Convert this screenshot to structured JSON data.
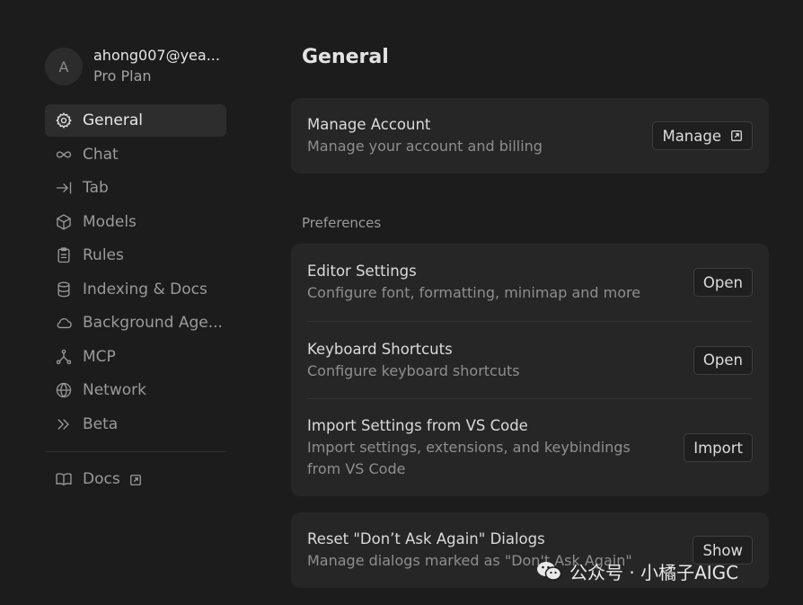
{
  "profile": {
    "avatar_letter": "A",
    "email": "ahong007@yea...",
    "plan": "Pro Plan"
  },
  "sidebar": {
    "items": [
      {
        "label": "General",
        "icon": "gear-icon",
        "active": true
      },
      {
        "label": "Chat",
        "icon": "infinity-icon"
      },
      {
        "label": "Tab",
        "icon": "arrow-to-line-icon"
      },
      {
        "label": "Models",
        "icon": "cube-icon"
      },
      {
        "label": "Rules",
        "icon": "clipboard-icon"
      },
      {
        "label": "Indexing & Docs",
        "icon": "database-icon"
      },
      {
        "label": "Background Age...",
        "icon": "cloud-icon"
      },
      {
        "label": "MCP",
        "icon": "network-nodes-icon"
      },
      {
        "label": "Network",
        "icon": "globe-icon"
      },
      {
        "label": "Beta",
        "icon": "double-chevron-right-icon"
      }
    ],
    "docs_label": "Docs"
  },
  "main": {
    "title": "General",
    "account": {
      "title": "Manage Account",
      "desc": "Manage your account and billing",
      "button": "Manage"
    },
    "preferences_label": "Preferences",
    "preferences": [
      {
        "title": "Editor Settings",
        "desc": "Configure font, formatting, minimap and more",
        "button": "Open"
      },
      {
        "title": "Keyboard Shortcuts",
        "desc": "Configure keyboard shortcuts",
        "button": "Open"
      },
      {
        "title": "Import Settings from VS Code",
        "desc": "Import settings, extensions, and keybindings from VS Code",
        "button": "Import"
      }
    ],
    "reset": {
      "title": "Reset \"Don’t Ask Again\" Dialogs",
      "desc": "Manage dialogs marked as \"Don't Ask Again\"",
      "button": "Show"
    }
  },
  "watermark": {
    "text": "公众号 · 小橘子AIGC"
  }
}
